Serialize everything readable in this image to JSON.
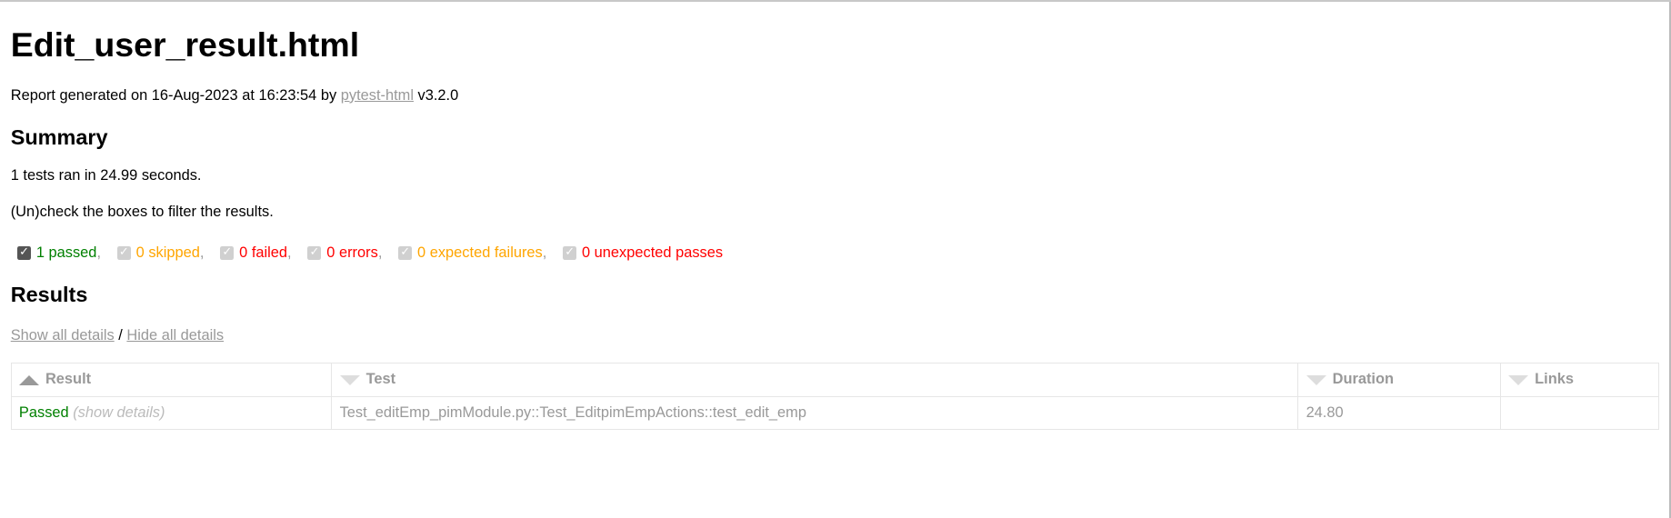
{
  "title": "Edit_user_result.html",
  "generated": {
    "prefix": "Report generated on 16-Aug-2023 at 16:23:54 by ",
    "link": "pytest-html",
    "suffix": " v3.2.0"
  },
  "summary": {
    "heading": "Summary",
    "ran": "1 tests ran in 24.99 seconds.",
    "hint": "(Un)check the boxes to filter the results."
  },
  "filters": [
    {
      "label": "1 passed",
      "color": "#008000",
      "checked": true
    },
    {
      "label": "0 skipped",
      "color": "#FFA500",
      "checked": false
    },
    {
      "label": "0 failed",
      "color": "#FF0000",
      "checked": false
    },
    {
      "label": "0 errors",
      "color": "#FF0000",
      "checked": false
    },
    {
      "label": "0 expected failures",
      "color": "#FFA500",
      "checked": false
    },
    {
      "label": "0 unexpected passes",
      "color": "#FF0000",
      "checked": false
    }
  ],
  "results": {
    "heading": "Results",
    "show_all": "Show all details",
    "slash": " / ",
    "hide_all": "Hide all details",
    "columns": [
      "Result",
      "Test",
      "Duration",
      "Links"
    ],
    "rows": [
      {
        "result": "Passed",
        "details": "(show details)",
        "test": "Test_editEmp_pimModule.py::Test_EditpimEmpActions::test_edit_emp",
        "duration": "24.80",
        "links": ""
      }
    ]
  }
}
